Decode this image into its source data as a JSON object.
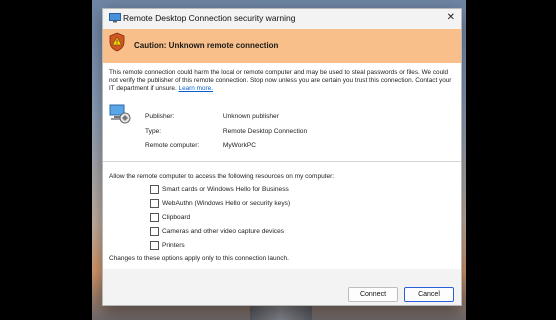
{
  "window": {
    "title": "Remote Desktop Connection security warning",
    "close_glyph": "✕"
  },
  "banner": {
    "text": "Caution: Unknown remote connection",
    "icon": "warning-shield-icon"
  },
  "description": {
    "text": "This remote connection could harm the local or remote computer and may be used to steal passwords or files. We could not verify the publisher of this remote connection. Stop now unless you are certain you trust this connection. Contact your IT department if unsure.",
    "link_text": "Learn more."
  },
  "details": [
    {
      "key": "Publisher:",
      "value": "Unknown publisher"
    },
    {
      "key": "Type:",
      "value": "Remote Desktop Connection"
    },
    {
      "key": "Remote computer:",
      "value": "MyWorkPC"
    }
  ],
  "resources": {
    "label": "Allow the remote computer to access the following resources on my computer:",
    "options": [
      {
        "label": "Smart cards or Windows Hello for Business",
        "checked": false
      },
      {
        "label": "WebAuthn (Windows Hello or security keys)",
        "checked": false
      },
      {
        "label": "Clipboard",
        "checked": false
      },
      {
        "label": "Cameras and other video capture devices",
        "checked": false
      },
      {
        "label": "Printers",
        "checked": false
      }
    ]
  },
  "note": "Changes to these options apply only to this connection launch.",
  "buttons": {
    "connect": "Connect",
    "cancel": "Cancel"
  },
  "colors": {
    "banner": "#f8bf8a",
    "link": "#0a5fcf",
    "default_button_border": "#2b5fd9"
  }
}
